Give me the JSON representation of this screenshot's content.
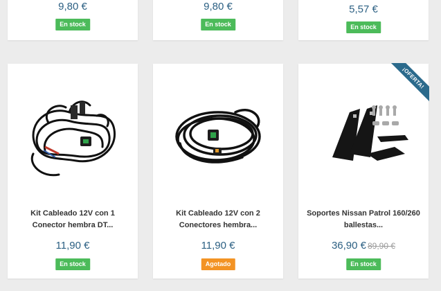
{
  "top_row": [
    {
      "price": "9,80 €",
      "stock": "En stock"
    },
    {
      "price": "9,80 €",
      "stock": "En stock"
    },
    {
      "price": "5,57 €",
      "stock": "En stock"
    }
  ],
  "products": [
    {
      "title_line1": "Kit Cableado 12V con 1",
      "title_line2": "Conector hembra DT...",
      "price": "11,90 €",
      "stock": "En stock",
      "stock_color": "#4cbb5a"
    },
    {
      "title_line1": "Kit Cableado 12V con 2",
      "title_line2": "Conectores hembra...",
      "price": "11,90 €",
      "stock": "Agotado",
      "stock_color": "#f39324"
    },
    {
      "title_line1": "Soportes Nissan Patrol 160/260",
      "title_line2": "ballestas...",
      "price": "36,90 €",
      "old_price": "89,90 €",
      "stock": "En stock",
      "stock_color": "#4cbb5a",
      "ribbon": "¡OFERTA!"
    }
  ],
  "colors": {
    "price": "#2c6083",
    "in_stock": "#4cbb5a",
    "out_of_stock": "#f39324",
    "ribbon": "#2b6a8c"
  }
}
